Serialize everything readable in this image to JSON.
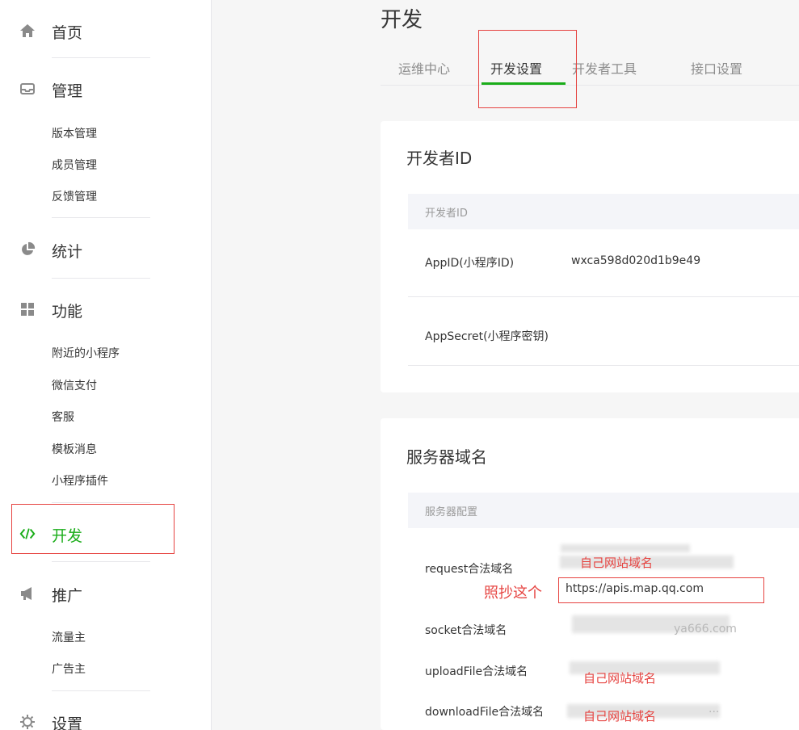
{
  "sidebar": {
    "home": "首页",
    "manage": {
      "label": "管理",
      "items": [
        "版本管理",
        "成员管理",
        "反馈管理"
      ]
    },
    "stats": "统计",
    "features": {
      "label": "功能",
      "items": [
        "附近的小程序",
        "微信支付",
        "客服",
        "模板消息",
        "小程序插件"
      ]
    },
    "dev": "开发",
    "promo": {
      "label": "推广",
      "items": [
        "流量主",
        "广告主"
      ]
    },
    "settings": "设置"
  },
  "page": {
    "title": "开发",
    "tabs": [
      "运维中心",
      "开发设置",
      "开发者工具",
      "接口设置"
    ],
    "active_tab": 1
  },
  "dev_id": {
    "title": "开发者ID",
    "header": "开发者ID",
    "rows": [
      {
        "label": "AppID(小程序ID)",
        "value": "wxca598d020d1b9e49"
      },
      {
        "label": "AppSecret(小程序密钥)",
        "value": ""
      }
    ]
  },
  "server": {
    "title": "服务器域名",
    "header": "服务器配置",
    "request_label": "request合法域名",
    "request_note": "自己网站域名",
    "request_value": "https://apis.map.qq.com",
    "copy_hint": "照抄这个",
    "socket_label": "socket合法域名",
    "socket_value_tail": "ya666.com",
    "upload_label": "uploadFile合法域名",
    "upload_note": "自己网站域名",
    "download_label": "downloadFile合法域名",
    "download_note": "自己网站域名",
    "download_tail": "..."
  },
  "colors": {
    "accent": "#1aad19",
    "annotation": "#e64340"
  },
  "icons": [
    "home-icon",
    "inbox-icon",
    "pie-chart-icon",
    "grid-icon",
    "code-icon",
    "megaphone-icon",
    "gear-icon"
  ]
}
